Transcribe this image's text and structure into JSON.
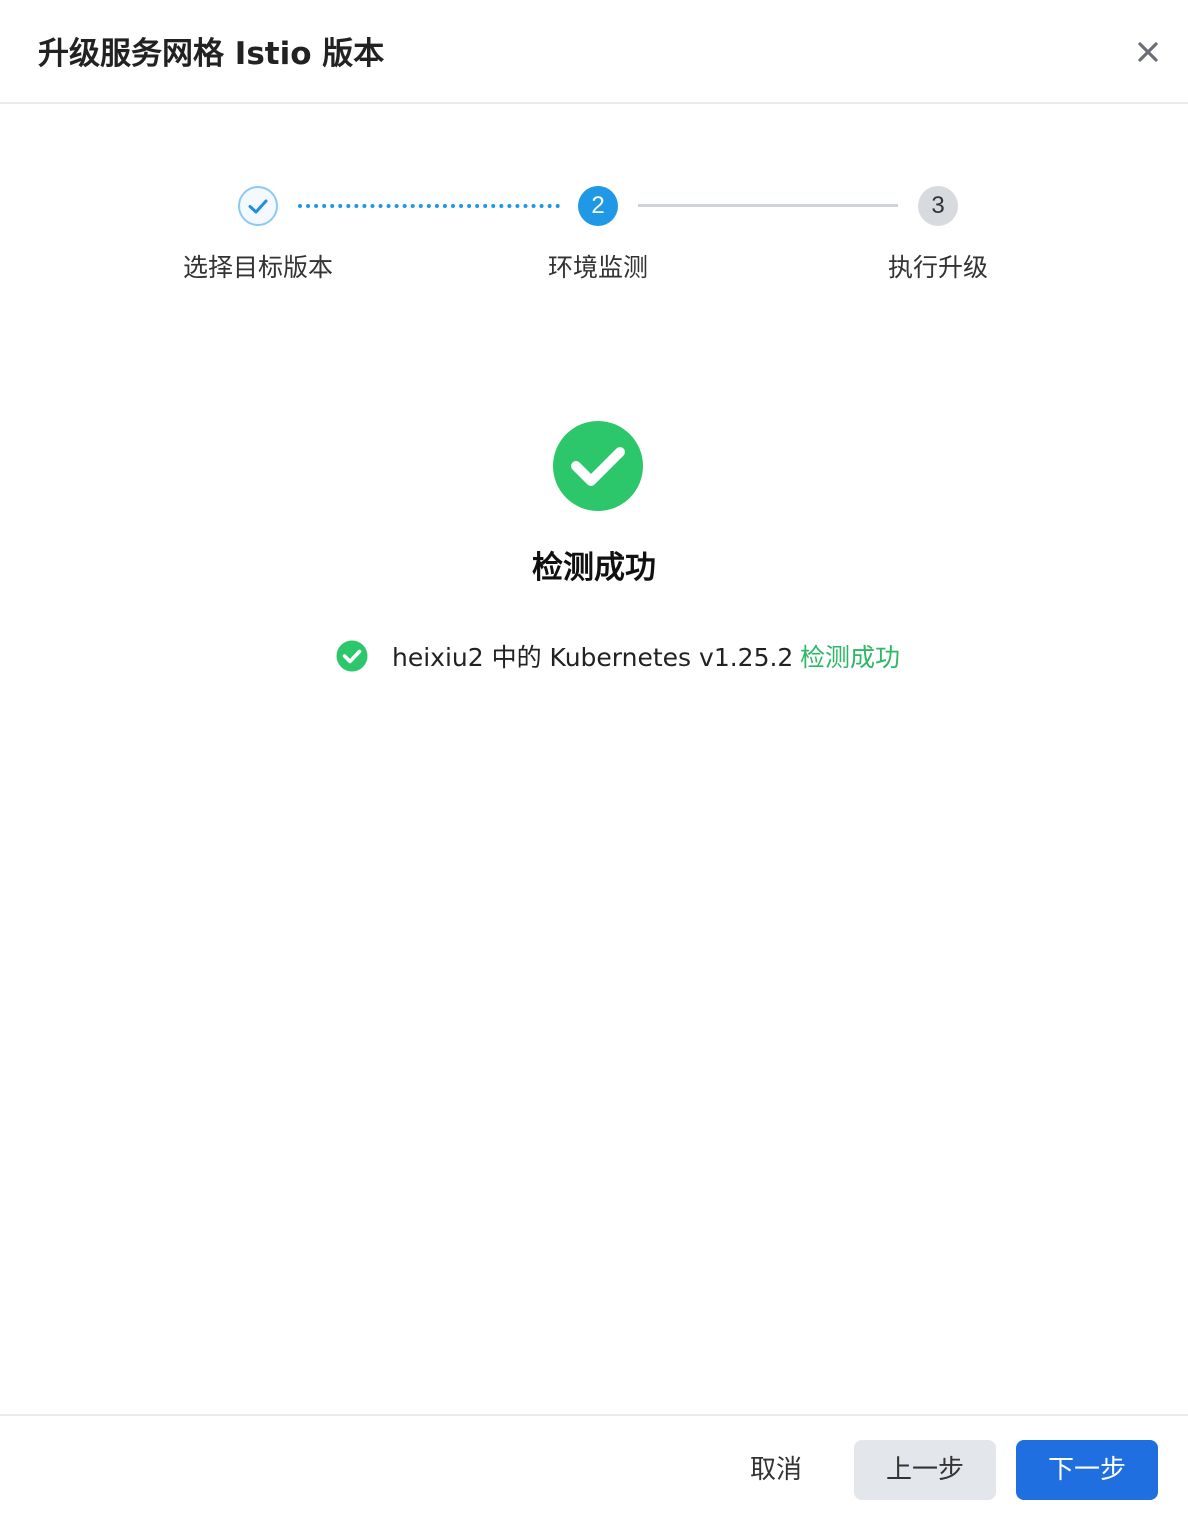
{
  "dialog": {
    "title": "升级服务网格 Istio 版本"
  },
  "steps": [
    {
      "index": "1",
      "label": "选择目标版本",
      "status": "completed"
    },
    {
      "index": "2",
      "label": "环境监测",
      "status": "active"
    },
    {
      "index": "3",
      "label": "执行升级",
      "status": "pending"
    }
  ],
  "result": {
    "title": "检测成功",
    "items": [
      {
        "text": "heixiu2 中的 Kubernetes v1.25.2",
        "status": "检测成功"
      }
    ]
  },
  "footer": {
    "cancel_label": "取消",
    "prev_label": "上一步",
    "next_label": "下一步"
  },
  "colors": {
    "primary": "#1f6fe0",
    "step_active": "#1f98e6",
    "success": "#2dc76b",
    "success_text": "#2db866",
    "pending": "#d7dadf"
  },
  "icons": {
    "close": "close-icon",
    "step_done": "check-icon",
    "result": "success-check-circle-icon",
    "row": "check-circle-icon"
  }
}
